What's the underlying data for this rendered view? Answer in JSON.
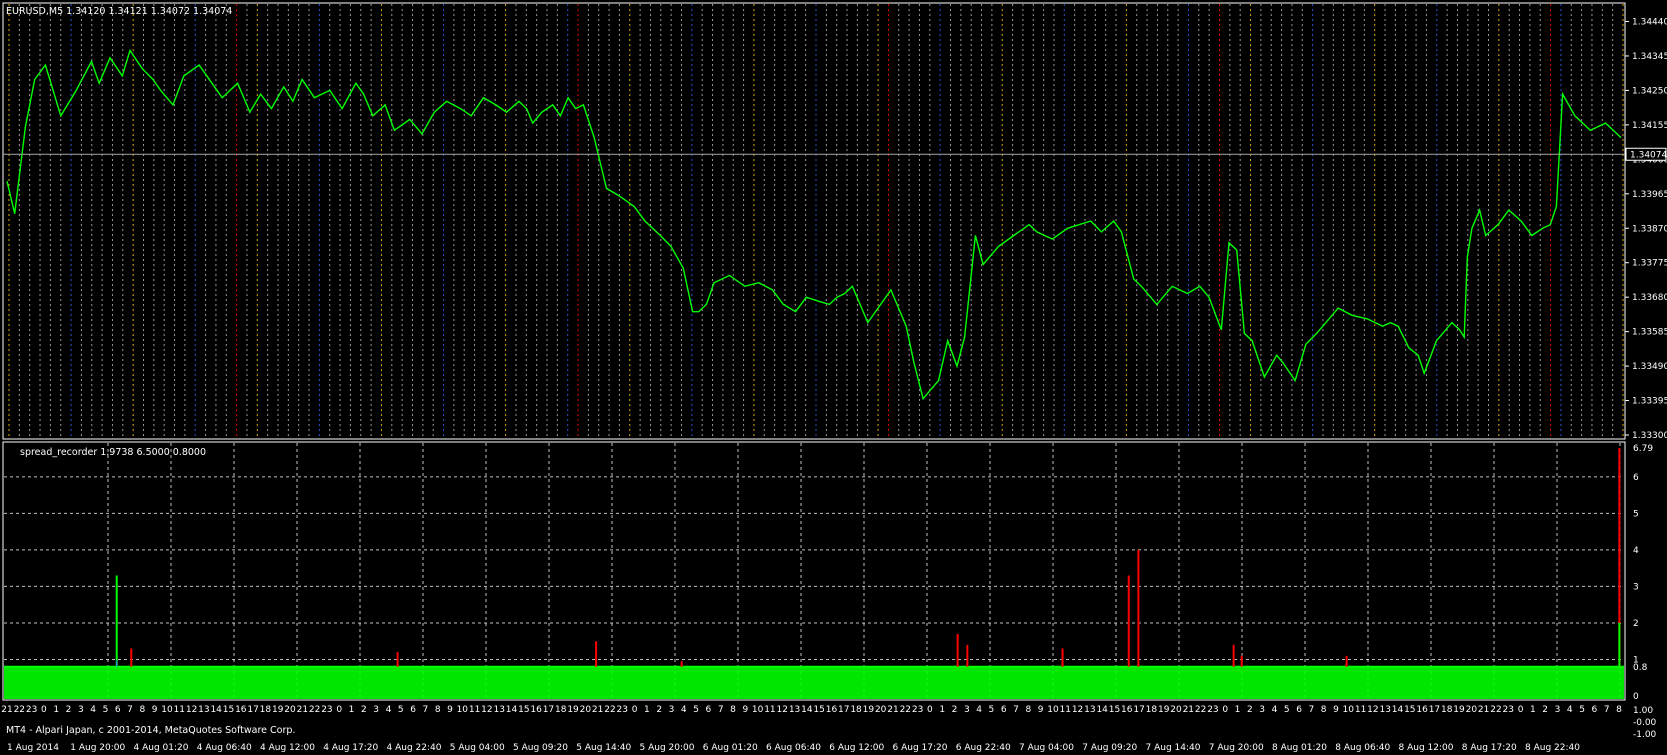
{
  "window": {
    "symbol_title": "EURUSD,M5  1.34120 1.34121 1.34072 1.34074",
    "footer": "MT4 - Alpari Japan, c 2001-2014, MetaQuotes Software Corp."
  },
  "colors": {
    "background": "#000000",
    "price_line": "#00ff00",
    "vgrid_default": "#ffffff",
    "vgrid_yellow": "#ffcc00",
    "vgrid_red": "#ff0000",
    "vgrid_blue": "#3366ff",
    "hgrid": "#ffffff",
    "spread_main": "#00ff00",
    "spread_spike": "#ff0000",
    "spread_blue": "#3366ff"
  },
  "chart_data": [
    {
      "type": "line",
      "panel": "price",
      "title": "EURUSD,M5  1.34120 1.34121 1.34072 1.34074",
      "yticks": [
        "1.34440",
        "1.34345",
        "1.34250",
        "1.34155",
        "1.34060",
        "1.33965",
        "1.33870",
        "1.33775",
        "1.33680",
        "1.33585",
        "1.33490",
        "1.33395",
        "1.33300"
      ],
      "ylim": [
        1.333,
        1.3448
      ],
      "current_price": "1.34074",
      "current_value": 1.34074,
      "grid": true,
      "series": [
        {
          "values": [
            1.34,
            1.3391,
            1.3415,
            1.3428,
            1.3432,
            1.3418,
            1.3425,
            1.3433,
            1.3427,
            1.3434,
            1.3429,
            1.3436,
            1.3431,
            1.3428,
            1.3425,
            1.3421,
            1.3429,
            1.3432,
            1.3426,
            1.3423,
            1.3427,
            1.3419,
            1.3424,
            1.342,
            1.3426,
            1.3422,
            1.3428,
            1.3423,
            1.3425,
            1.342,
            1.3427,
            1.3424,
            1.3418,
            1.3421,
            1.3414,
            1.3417,
            1.3413,
            1.3419,
            1.3422,
            1.342,
            1.3418,
            1.3423,
            1.3421,
            1.3419,
            1.3422,
            1.342,
            1.3416,
            1.3419,
            1.3421,
            1.3418,
            1.3423,
            1.342,
            1.3421,
            1.3412,
            1.3405,
            1.3398,
            1.3396,
            1.3393,
            1.3389,
            1.3385,
            1.3382,
            1.3376,
            1.3364,
            1.3364,
            1.3366,
            1.3372,
            1.3374,
            1.3371,
            1.3372,
            1.337,
            1.3366,
            1.3364,
            1.3368,
            1.3367,
            1.3366,
            1.3368,
            1.3369,
            1.3371,
            1.3366,
            1.3361,
            1.337,
            1.336,
            1.335,
            1.334,
            1.3345,
            1.3356,
            1.3349,
            1.3357,
            1.3385,
            1.3377,
            1.3382,
            1.3385,
            1.3388,
            1.3386,
            1.3384,
            1.3387,
            1.3389,
            1.3386,
            1.3389,
            1.3386,
            1.3373,
            1.3371,
            1.3366,
            1.3371,
            1.3369,
            1.3371,
            1.3368,
            1.3359,
            1.3383,
            1.3381,
            1.3358,
            1.3356,
            1.3346,
            1.3352,
            1.335,
            1.3345,
            1.3355,
            1.3358,
            1.3361,
            1.3365,
            1.3363,
            1.3362,
            1.336,
            1.3361,
            1.336,
            1.3354,
            1.3352,
            1.3347,
            1.3356,
            1.3361,
            1.3359,
            1.3357,
            1.3379,
            1.3387,
            1.3392,
            1.3385,
            1.3388,
            1.3392,
            1.3389,
            1.3385,
            1.3387,
            1.3388,
            1.3393,
            1.3424,
            1.3418,
            1.3414,
            1.3416,
            1.3412,
            1.341,
            1.3407
          ],
          "x_fraction": [
            0.0,
            0.005,
            0.012,
            0.018,
            0.025,
            0.035,
            0.045,
            0.055,
            0.06,
            0.067,
            0.075,
            0.08,
            0.088,
            0.095,
            0.1,
            0.108,
            0.115,
            0.125,
            0.135,
            0.14,
            0.15,
            0.158,
            0.165,
            0.172,
            0.18,
            0.186,
            0.192,
            0.2,
            0.21,
            0.218,
            0.227,
            0.232,
            0.238,
            0.246,
            0.252,
            0.262,
            0.27,
            0.278,
            0.286,
            0.295,
            0.302,
            0.31,
            0.318,
            0.325,
            0.333,
            0.338,
            0.342,
            0.348,
            0.355,
            0.36,
            0.365,
            0.37,
            0.375,
            0.382,
            0.386,
            0.39,
            0.398,
            0.408,
            0.415,
            0.425,
            0.432,
            0.44,
            0.446,
            0.45,
            0.455,
            0.46,
            0.47,
            0.48,
            0.489,
            0.498,
            0.505,
            0.513,
            0.52,
            0.527,
            0.535,
            0.54,
            0.545,
            0.55,
            0.555,
            0.56,
            0.575,
            0.585,
            0.59,
            0.596,
            0.606,
            0.612,
            0.618,
            0.623,
            0.63,
            0.635,
            0.645,
            0.655,
            0.665,
            0.67,
            0.68,
            0.69,
            0.705,
            0.712,
            0.72,
            0.725,
            0.733,
            0.738,
            0.748,
            0.758,
            0.768,
            0.776,
            0.782,
            0.79,
            0.795,
            0.8,
            0.805,
            0.81,
            0.818,
            0.826,
            0.83,
            0.838,
            0.845,
            0.852,
            0.858,
            0.866,
            0.875,
            0.885,
            0.895,
            0.9,
            0.905,
            0.912,
            0.918,
            0.922,
            0.93,
            0.94,
            0.945,
            0.948,
            0.95,
            0.953,
            0.958,
            0.962,
            0.97,
            0.977,
            0.985,
            0.992,
            0.999,
            1.004,
            1.008,
            1.012,
            1.02,
            1.03,
            1.04,
            1.05
          ]
        }
      ]
    },
    {
      "type": "area",
      "panel": "indicator",
      "title": "spread_recorder 1.9738 6.5000 0.8000",
      "yticks": [
        "6.79",
        "6",
        "5",
        "4",
        "3",
        "2",
        "1",
        "0.8",
        "0"
      ],
      "ylim": [
        0,
        6.79
      ],
      "baseline_value": 0.8,
      "spikes": [
        {
          "x_fraction": 0.068,
          "value": 3.3,
          "color": "green"
        },
        {
          "x_fraction": 0.077,
          "value": 1.3,
          "color": "red"
        },
        {
          "x_fraction": 0.242,
          "value": 1.2,
          "color": "red"
        },
        {
          "x_fraction": 0.365,
          "value": 1.5,
          "color": "red"
        },
        {
          "x_fraction": 0.418,
          "value": 0.95,
          "color": "red"
        },
        {
          "x_fraction": 0.589,
          "value": 1.7,
          "color": "red"
        },
        {
          "x_fraction": 0.595,
          "value": 1.4,
          "color": "red"
        },
        {
          "x_fraction": 0.654,
          "value": 1.3,
          "color": "red"
        },
        {
          "x_fraction": 0.695,
          "value": 3.3,
          "color": "red"
        },
        {
          "x_fraction": 0.701,
          "value": 4.0,
          "color": "red"
        },
        {
          "x_fraction": 0.76,
          "value": 1.4,
          "color": "red"
        },
        {
          "x_fraction": 0.765,
          "value": 1.1,
          "color": "red"
        },
        {
          "x_fraction": 0.83,
          "value": 1.1,
          "color": "red"
        },
        {
          "x_fraction": 0.999,
          "value": 6.79,
          "color": "red"
        },
        {
          "x_fraction": 0.999,
          "value": 2.0,
          "color": "green"
        }
      ],
      "grid": true
    }
  ],
  "time_axis": {
    "date_labels": [
      "1 Aug 2014",
      "1 Aug 20:00",
      "4 Aug 01:20",
      "4 Aug 06:40",
      "4 Aug 12:00",
      "4 Aug 17:20",
      "4 Aug 22:40",
      "5 Aug 04:00",
      "5 Aug 09:20",
      "5 Aug 14:40",
      "5 Aug 20:00",
      "6 Aug 01:20",
      "6 Aug 06:40",
      "6 Aug 12:00",
      "6 Aug 17:20",
      "6 Aug 22:40",
      "7 Aug 04:00",
      "7 Aug 09:20",
      "7 Aug 14:40",
      "7 Aug 20:00",
      "8 Aug 01:20",
      "8 Aug 06:40",
      "8 Aug 12:00",
      "8 Aug 17:20",
      "8 Aug 22:40"
    ],
    "hour_labels": [
      "21",
      "22",
      "23",
      "0",
      "1",
      "2",
      "3",
      "4",
      "5",
      "6",
      "7",
      "8",
      "9",
      "10",
      "11",
      "12",
      "13",
      "14",
      "15",
      "16",
      "17",
      "18",
      "19",
      "20",
      "21",
      "22",
      "23",
      "0",
      "1",
      "2",
      "3",
      "4",
      "5",
      "6",
      "7",
      "8",
      "9",
      "10",
      "11",
      "12",
      "13",
      "14",
      "15",
      "16",
      "17",
      "18",
      "19",
      "20",
      "21",
      "22",
      "23",
      "0",
      "1",
      "2",
      "3",
      "4",
      "5",
      "6",
      "7",
      "8",
      "9",
      "10",
      "11",
      "12",
      "13",
      "14",
      "15",
      "16",
      "17",
      "18",
      "19",
      "20",
      "21",
      "22",
      "23",
      "0",
      "1",
      "2",
      "3",
      "4",
      "5",
      "6",
      "7",
      "8",
      "9",
      "10",
      "11",
      "12",
      "13",
      "14",
      "15",
      "16",
      "17",
      "18",
      "19",
      "20",
      "21",
      "22",
      "23",
      "0",
      "1",
      "2",
      "3",
      "4",
      "5",
      "6",
      "7",
      "8",
      "9",
      "10",
      "11",
      "12",
      "13",
      "14",
      "15",
      "16",
      "17",
      "18",
      "19",
      "20",
      "21",
      "22",
      "23",
      "0",
      "1",
      "2",
      "3",
      "4",
      "5",
      "6",
      "7",
      "8"
    ],
    "lower_scale": [
      "1.00",
      "-0.00",
      "-1.00"
    ]
  }
}
